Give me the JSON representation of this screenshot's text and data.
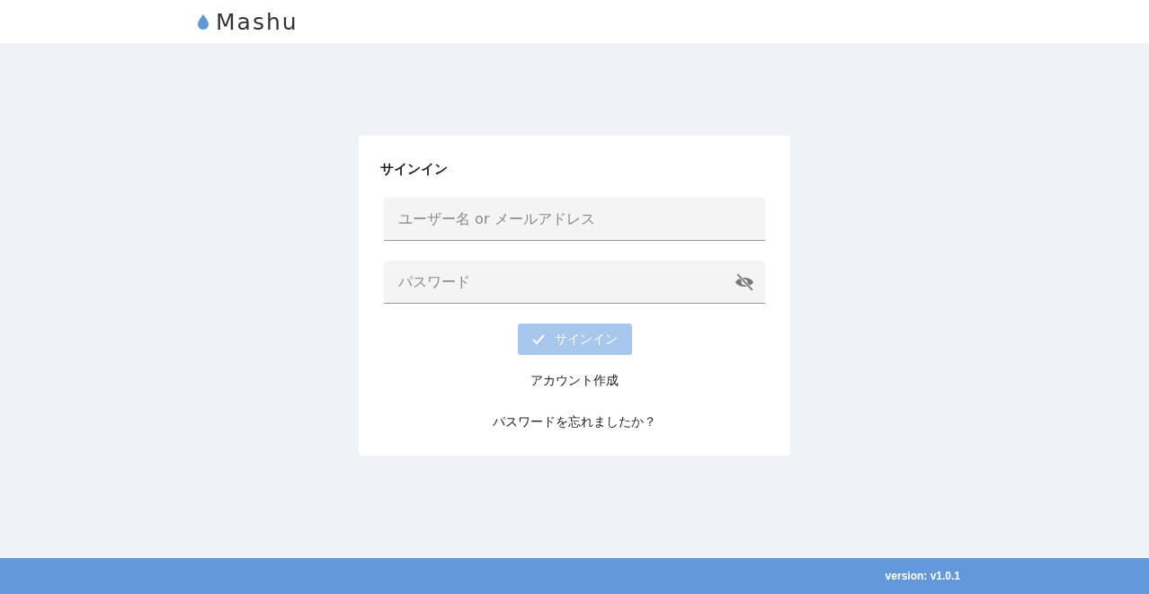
{
  "header": {
    "logo": "Mashu"
  },
  "signin": {
    "title": "サインイン",
    "fields": [
      {
        "kind": "text",
        "placeholder": "ユーザー名 or メールアドレス"
      },
      {
        "kind": "password",
        "placeholder": "パスワード",
        "visible": false
      }
    ],
    "button": {
      "label": "サインイン",
      "disabled": true
    },
    "links": [
      "アカウント作成",
      "パスワードを忘れましたか？"
    ]
  },
  "footer": {
    "version": "version: v1.0.1"
  }
}
